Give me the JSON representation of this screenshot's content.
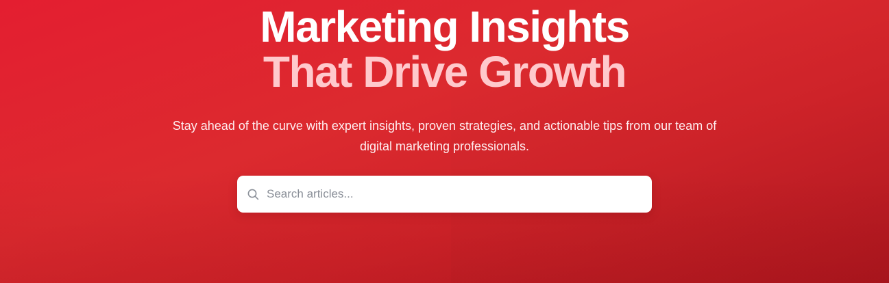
{
  "hero": {
    "headline_line1": "Marketing Insights",
    "headline_line2": "That Drive Growth",
    "subtitle": "Stay ahead of the curve with expert insights, proven strategies, and actionable tips from our team of digital marketing professionals."
  },
  "search": {
    "placeholder": "Search articles...",
    "value": "",
    "icon": "search-icon"
  },
  "colors": {
    "background_start": "#e41e30",
    "background_end": "#b0171f",
    "headline_primary": "#ffffff",
    "headline_accent": "#ffc9cc",
    "search_background": "#ffffff",
    "placeholder": "#8a8f98"
  }
}
